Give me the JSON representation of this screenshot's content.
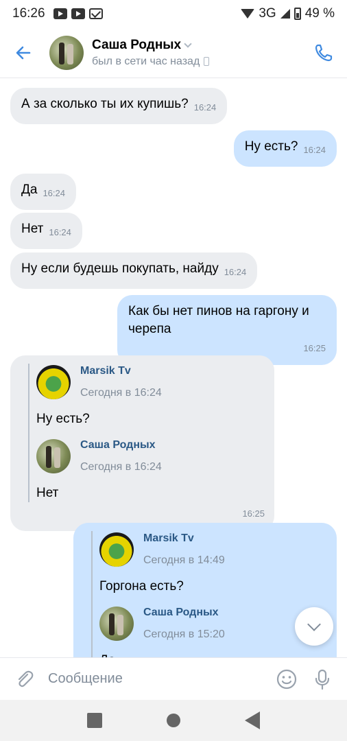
{
  "status_bar": {
    "time": "16:26",
    "network": "3G",
    "battery": "49 %"
  },
  "header": {
    "contact_name": "Саша Родных",
    "contact_status": "был в сети час назад"
  },
  "messages": [
    {
      "dir": "in",
      "text": "А за сколько ты их купишь?",
      "time": "16:24"
    },
    {
      "dir": "out",
      "text": "Ну есть?",
      "time": "16:24"
    },
    {
      "dir": "in",
      "text": "Да",
      "time": "16:24"
    },
    {
      "dir": "in",
      "text": "Нет",
      "time": "16:24"
    },
    {
      "dir": "in",
      "text": "Ну если будешь покупать, найду",
      "time": "16:24"
    },
    {
      "dir": "out",
      "text": "Как бы нет пинов на гаргону и черепа",
      "time": "16:25"
    }
  ],
  "forward_in": {
    "time": "16:25",
    "items": [
      {
        "author": "Marsik Tv",
        "date": "Сегодня в 16:24",
        "text": "Ну есть?"
      },
      {
        "author": "Саша Родных",
        "date": "Сегодня в 16:24",
        "text": "Нет"
      }
    ]
  },
  "forward_out": {
    "items": [
      {
        "author": "Marsik Tv",
        "date": "Сегодня в 14:49",
        "text": "Горгона есть?"
      },
      {
        "author": "Саша Родных",
        "date": "Сегодня в 15:20",
        "text": "Да"
      }
    ]
  },
  "composer": {
    "placeholder": "Сообщение"
  },
  "icons": {
    "back": "arrow-left-icon",
    "call": "phone-icon",
    "attach": "paperclip-icon",
    "emoji": "smile-icon",
    "mic": "microphone-icon",
    "scroll": "chevron-down-icon"
  },
  "colors": {
    "accent": "#3f8ae0",
    "incoming": "#ebedf0",
    "outgoing": "#cce4ff",
    "link": "#2a5885"
  }
}
